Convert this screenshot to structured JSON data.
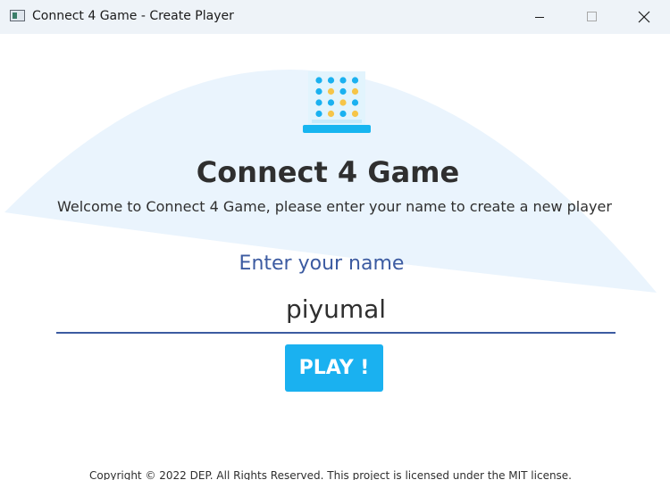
{
  "window": {
    "title": "Connect 4 Game - Create Player",
    "controls": [
      "minimize-icon",
      "maximize-icon",
      "close-icon"
    ]
  },
  "logo": {
    "icon": "connect-four-board-icon",
    "colors": {
      "board": "#e2f4fd",
      "base": "#17b5f0",
      "disc_blue": "#1ab1f0",
      "disc_yellow": "#f6c548"
    }
  },
  "main": {
    "heading": "Connect 4 Game",
    "welcome": "Welcome to Connect 4 Game, please enter your name to create a new player",
    "name_label": "Enter your name",
    "name_value": "piyumal",
    "play_label": "PLAY !"
  },
  "footer": {
    "copyright": "Copyright © 2022 DEP. All Rights Reserved. This project is licensed under the MIT license."
  },
  "colors": {
    "accent": "#1ab1f0",
    "label": "#3c5ba1",
    "background_shape": "#eaf4fd"
  }
}
